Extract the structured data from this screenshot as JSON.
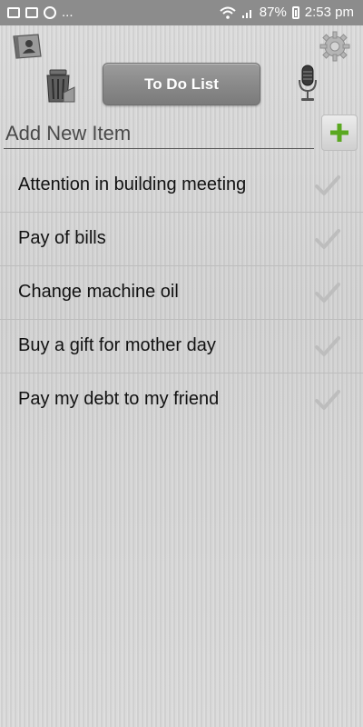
{
  "status_bar": {
    "dots": "...",
    "battery_percent": "87%",
    "time": "2:53 pm"
  },
  "toolbar": {
    "title": "To Do List",
    "icons": [
      "contacts-icon",
      "trash-icon",
      "gear-icon",
      "microphone-icon"
    ]
  },
  "add_item": {
    "placeholder": "Add New Item",
    "value": "",
    "add_icon": "plus-icon"
  },
  "items": [
    {
      "label": "Attention in building meeting"
    },
    {
      "label": "Pay of bills"
    },
    {
      "label": "Change machine oil"
    },
    {
      "label": "Buy a gift for mother day"
    },
    {
      "label": "Pay my debt to my friend"
    }
  ],
  "colors": {
    "background": "#d4d4d4",
    "title_button": "#8a8a8a",
    "add_plus": "#5aa820",
    "status_bar": "#8c8c8c"
  }
}
